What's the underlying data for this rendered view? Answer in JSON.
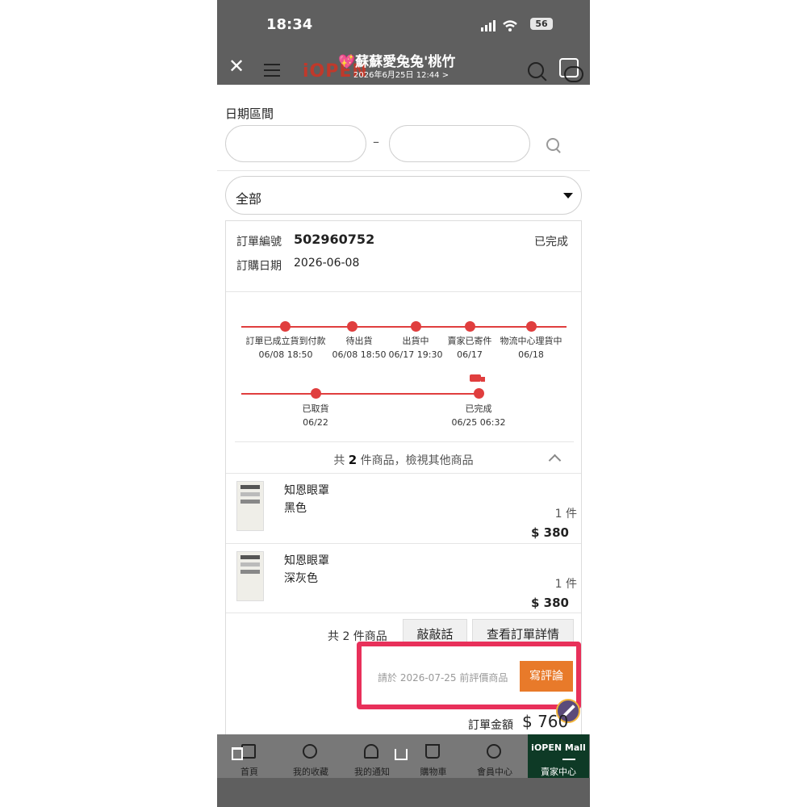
{
  "status_bar": {
    "time": "18:34",
    "battery": "56"
  },
  "header": {
    "logo": "iOPEN",
    "chat_title": "💖蘇蘇愛兔兔'桃竹",
    "chat_subtitle": "2026年6月25日 12:44 >"
  },
  "filter": {
    "date_range_label": "日期區間",
    "dash": "–",
    "status_select": "全部"
  },
  "order": {
    "id_label": "訂單編號",
    "id_value": "502960752",
    "status": "已完成",
    "date_label": "訂購日期",
    "date_value": "2026-06-08",
    "timeline_row1": [
      {
        "label": "訂單已成立貨到付款",
        "time": "06/08 18:50"
      },
      {
        "label": "待出貨",
        "time": "06/08 18:50"
      },
      {
        "label": "出貨中",
        "time": "06/17 19:30"
      },
      {
        "label": "賣家已寄件",
        "time": "06/17"
      },
      {
        "label": "物流中心理貨中",
        "time": "06/18"
      }
    ],
    "timeline_row2": [
      {
        "label": "已取貨",
        "time": "06/22"
      },
      {
        "label": "已完成",
        "time": "06/25 06:32"
      }
    ],
    "summary_prefix": "共",
    "summary_count": "2",
    "summary_suffix": "件商品，檢視其他商品",
    "items": [
      {
        "name": "知恩眼罩",
        "variant": "黑色",
        "qty": "1 件",
        "price": "$ 380"
      },
      {
        "name": "知恩眼罩",
        "variant": "深灰色",
        "qty": "1 件",
        "price": "$ 380"
      }
    ],
    "footer_count": "共 2 件商品",
    "knock_button": "敲敲話",
    "detail_button": "查看訂單詳情",
    "review_hint": "請於 2026-07-25 前評價商品",
    "review_button": "寫評論",
    "total_label": "訂單金額",
    "total_value": "$ 760"
  },
  "tabbar": {
    "home": "首頁",
    "favorites": "我的收藏",
    "notifications": "我的通知",
    "cart": "購物車",
    "member": "會員中心",
    "seller_logo": "iOPEN Mall",
    "seller": "賣家中心"
  },
  "colors": {
    "accent": "#e03e3e",
    "review_button": "#e87a2a",
    "highlight": "#e8305a",
    "seller_bg": "#0e3a26"
  }
}
